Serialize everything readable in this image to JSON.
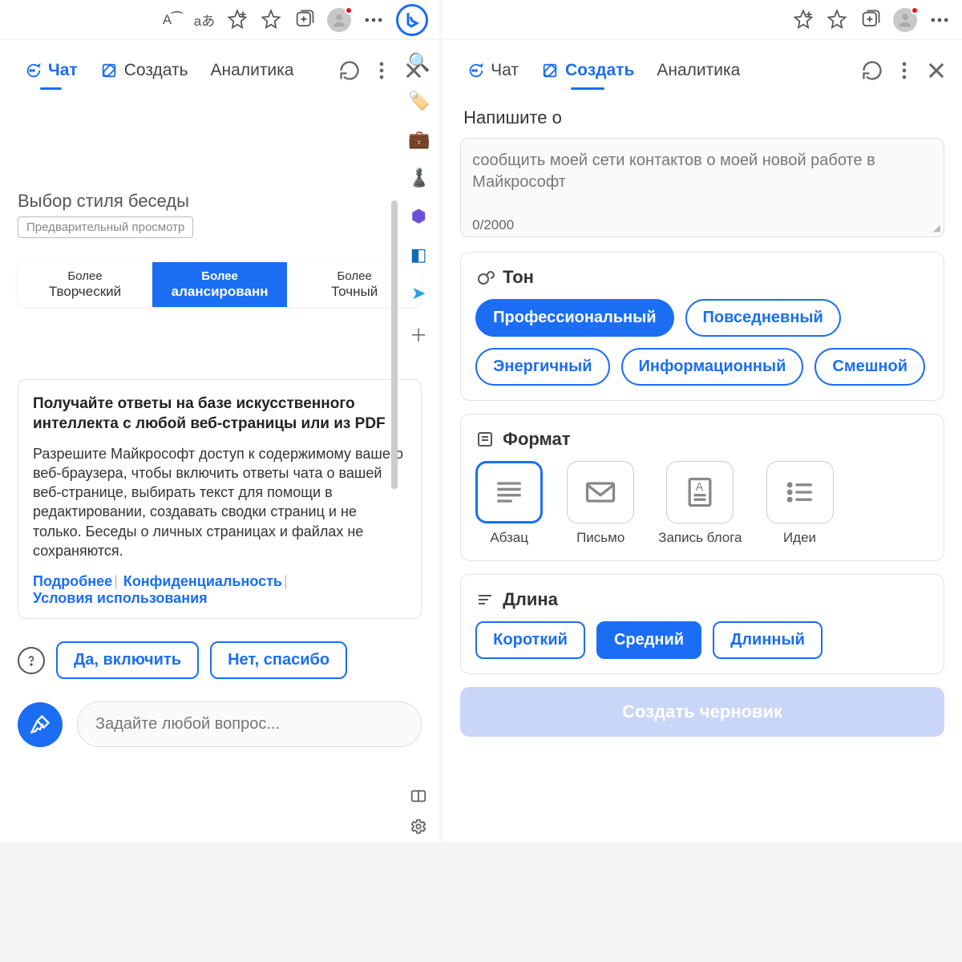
{
  "left": {
    "toolbar": {
      "read_aloud": "A⁀",
      "translate": "aあ"
    },
    "tabs": {
      "chat": "Чат",
      "compose": "Создать",
      "insights": "Аналитика",
      "active": "chat"
    },
    "style": {
      "label": "Выбор стиля беседы",
      "preview": "Предварительный просмотр",
      "options": [
        {
          "top": "Более",
          "bottom": "Творческий",
          "selected": false
        },
        {
          "top": "Более",
          "bottom": "алансированн",
          "selected": true
        },
        {
          "top": "Более",
          "bottom": "Точный",
          "selected": false
        }
      ]
    },
    "info": {
      "title": "Получайте ответы на базе искусственного интеллекта с любой веб-страницы или из PDF",
      "body": "Разрешите Майкрософт доступ к содержимому вашего веб-браузера, чтобы включить ответы чата о вашей веб-странице, выбирать текст для помощи в редактировании, создавать сводки страниц и не только. Беседы о личных страницах и файлах не сохраняются.",
      "links": {
        "more": "Подробнее",
        "privacy": "Конфиденциальность",
        "terms": "Условия использования"
      }
    },
    "consent": {
      "yes": "Да, включить",
      "no": "Нет, спасибо"
    },
    "ask": {
      "placeholder": "Задайте любой вопрос..."
    }
  },
  "right": {
    "tabs": {
      "chat": "Чат",
      "compose": "Создать",
      "insights": "Аналитика",
      "active": "compose"
    },
    "write": {
      "label": "Напишите о",
      "placeholder": "сообщить моей сети контактов о моей новой работе в Майкрософт",
      "counter": "0/2000"
    },
    "tone": {
      "label": "Тон",
      "options": [
        {
          "label": "Профессиональный",
          "selected": true
        },
        {
          "label": "Повседневный",
          "selected": false
        },
        {
          "label": "Энергичный",
          "selected": false
        },
        {
          "label": "Информационный",
          "selected": false
        },
        {
          "label": "Смешной",
          "selected": false
        }
      ]
    },
    "format": {
      "label": "Формат",
      "options": [
        {
          "label": "Абзац",
          "selected": true,
          "icon": "paragraph"
        },
        {
          "label": "Письмо",
          "selected": false,
          "icon": "email"
        },
        {
          "label": "Запись блога",
          "selected": false,
          "icon": "blog"
        },
        {
          "label": "Идеи",
          "selected": false,
          "icon": "ideas"
        }
      ]
    },
    "length": {
      "label": "Длина",
      "options": [
        {
          "label": "Короткий",
          "selected": false
        },
        {
          "label": "Средний",
          "selected": true
        },
        {
          "label": "Длинный",
          "selected": false
        }
      ]
    },
    "generate": "Создать черновик"
  }
}
